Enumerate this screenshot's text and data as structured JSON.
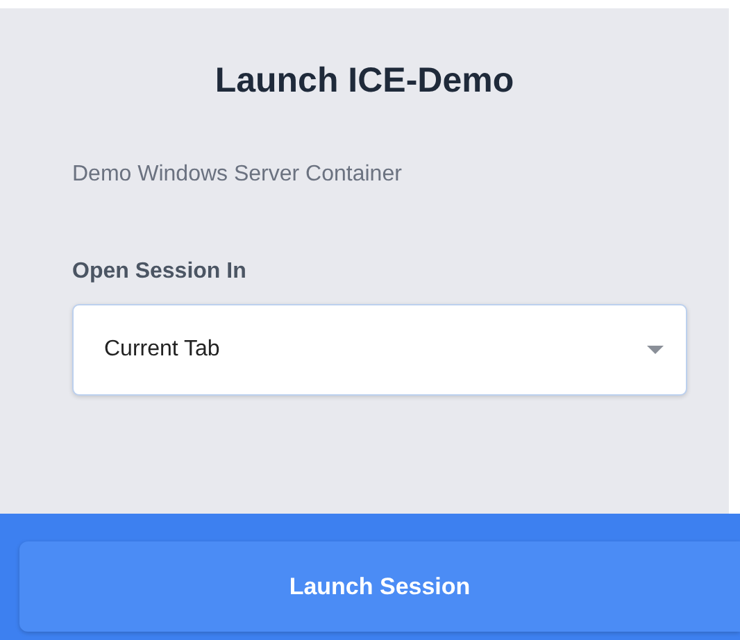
{
  "dialog": {
    "title": "Launch ICE-Demo",
    "description": "Demo Windows Server Container"
  },
  "field": {
    "label": "Open Session In",
    "value": "Current Tab"
  },
  "button": {
    "label": "Launch Session"
  }
}
